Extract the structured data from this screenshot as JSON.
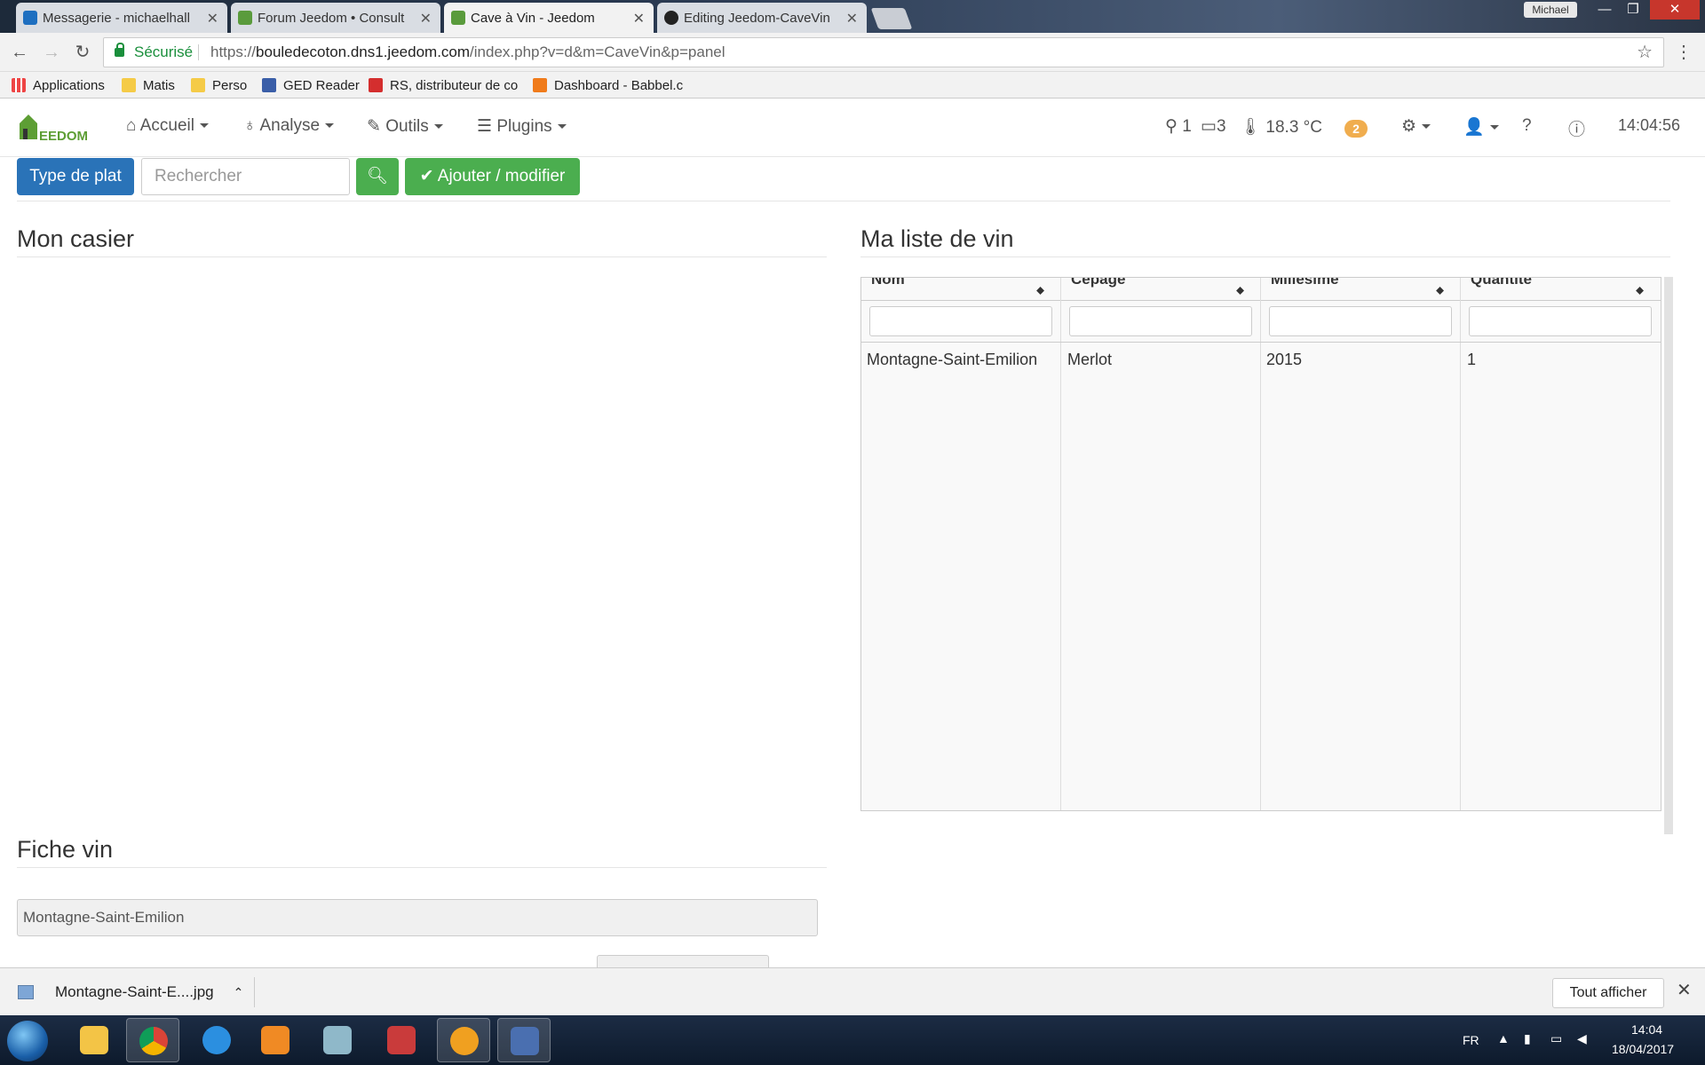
{
  "browser": {
    "tabs": [
      {
        "label": "Messagerie - michaelhall",
        "active": false
      },
      {
        "label": "Forum Jeedom • Consult",
        "active": false
      },
      {
        "label": "Cave à Vin - Jeedom",
        "active": true
      },
      {
        "label": "Editing Jeedom-CaveVin",
        "active": false
      }
    ],
    "user_chip": "Michael",
    "address": {
      "secure_label": "Sécurisé",
      "url_scheme": "https://",
      "url_host": "bouledecoton.dns1.jeedom.com",
      "url_path": "/index.php?v=d&m=CaveVin&p=panel"
    },
    "bookmarks": [
      "Applications",
      "Matis",
      "Perso",
      "GED Reader",
      "RS, distributeur de co",
      "Dashboard - Babbel.c"
    ]
  },
  "jeedom_nav": {
    "menus": [
      "Accueil",
      "Analyse",
      "Outils",
      "Plugins"
    ],
    "status": {
      "motion_count": "1",
      "door_count": "3",
      "temperature": "18.3 °C"
    },
    "message_badge": "2",
    "clock": "14:04:56"
  },
  "toolbar": {
    "type_button": "Type de plat",
    "search_placeholder": "Rechercher",
    "add_button": "Ajouter / modifier"
  },
  "sections": {
    "casier_title": "Mon casier",
    "liste_title": "Ma liste de vin",
    "fiche_title": "Fiche vin"
  },
  "wine_table": {
    "columns": [
      "Nom",
      "Cepage",
      "Millesime",
      "Quantite"
    ],
    "rows": [
      [
        "Montagne-Saint-Emilion",
        "Merlot",
        "2015",
        "1"
      ]
    ]
  },
  "fiche": {
    "name_value": "Montagne-Saint-Emilion"
  },
  "download_bar": {
    "file_name": "Montagne-Saint-E....jpg",
    "show_all": "Tout afficher"
  },
  "taskbar": {
    "lang": "FR",
    "time": "14:04",
    "date": "18/04/2017"
  }
}
